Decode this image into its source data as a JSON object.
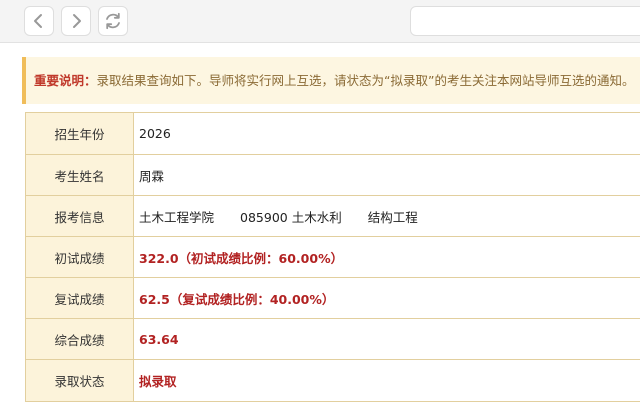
{
  "notice": {
    "label": "重要说明：",
    "text": "录取结果查询如下。导师将实行网上互选，请状态为“拟录取”的考生关注本网站导师互选的通知。"
  },
  "table": {
    "year": {
      "key": "招生年份",
      "value": "2026"
    },
    "name": {
      "key": "考生姓名",
      "value": "周霖"
    },
    "apply": {
      "key": "报考信息",
      "college": "土木工程学院",
      "major": "085900 土木水利",
      "direction": "结构工程"
    },
    "initial_score": {
      "key": "初试成绩",
      "value": "322.0（初试成绩比例：60.00%）"
    },
    "retest_score": {
      "key": "复试成绩",
      "value": "62.5（复试成绩比例：40.00%）"
    },
    "total_score": {
      "key": "综合成绩",
      "value": "63.64"
    },
    "status": {
      "key": "录取状态",
      "value": "拟录取"
    }
  },
  "colors": {
    "highlight": "#b22222",
    "key_cell_bg": "#fcf3da",
    "border": "#e2cf9e",
    "notice_bg": "#fdf6e1",
    "notice_bar": "#f0bd5a"
  },
  "icons": {
    "back": "chevron-left-icon",
    "forward": "chevron-right-icon",
    "reload": "reload-icon"
  }
}
